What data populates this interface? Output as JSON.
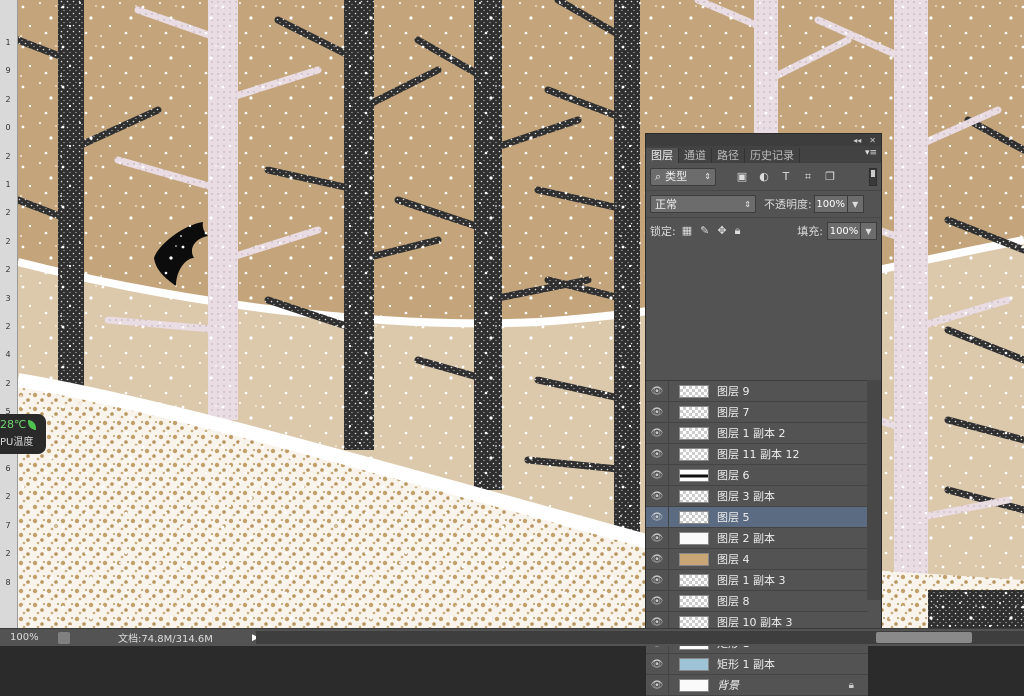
{
  "ruler": {
    "ticks": [
      "1",
      "9",
      "2",
      "0",
      "2",
      "1",
      "2",
      "2",
      "2",
      "3",
      "2",
      "4",
      "2",
      "5",
      "2",
      "6",
      "2",
      "7",
      "2",
      "8"
    ]
  },
  "widget": {
    "temperature": "28℃",
    "label": "PU温度"
  },
  "status": {
    "zoom": "100%",
    "doc": "文档:74.8M/314.6M",
    "arrow": "▶"
  },
  "panel": {
    "top_controls": {
      "collapse": "◂◂",
      "close": "✕"
    },
    "tabs": [
      "图层",
      "通道",
      "路径",
      "历史记录"
    ],
    "tab_menu": "▾≡",
    "filter": {
      "label": "类型",
      "icons": [
        "image-filter-icon",
        "adjustment-filter-icon",
        "type-filter-icon",
        "shape-filter-icon",
        "smart-object-filter-icon"
      ]
    },
    "blend_mode": "正常",
    "opacity_label": "不透明度:",
    "opacity_value": "100%",
    "lock_label": "锁定:",
    "fill_label": "填充:",
    "fill_value": "100%",
    "layers": [
      {
        "name": "图层 9",
        "thumb": "checker",
        "selected": false
      },
      {
        "name": "图层 7",
        "thumb": "checker",
        "selected": false
      },
      {
        "name": "图层 1 副本 2",
        "thumb": "checker",
        "selected": false
      },
      {
        "name": "图层 11 副本 12",
        "thumb": "checker",
        "selected": false
      },
      {
        "name": "图层 6",
        "thumb": "dark",
        "selected": false
      },
      {
        "name": "图层 3 副本",
        "thumb": "checker",
        "selected": false
      },
      {
        "name": "图层 5",
        "thumb": "checker",
        "selected": true
      },
      {
        "name": "图层 2 副本",
        "thumb": "white",
        "selected": false
      },
      {
        "name": "图层 4",
        "thumb": "tan",
        "selected": false
      },
      {
        "name": "图层 1 副本 3",
        "thumb": "checker",
        "selected": false
      },
      {
        "name": "图层 8",
        "thumb": "checker",
        "selected": false
      },
      {
        "name": "图层 10 副本 3",
        "thumb": "checker",
        "selected": false
      },
      {
        "name": "矩形 1",
        "thumb": "white",
        "selected": false
      },
      {
        "name": "矩形 1 副本",
        "thumb": "blue",
        "selected": false
      },
      {
        "name": "背景",
        "thumb": "white",
        "selected": false,
        "locked": true
      }
    ]
  },
  "colors": {
    "sky": "#c4a57b",
    "snow": "#ffffff",
    "trunk_dark": "#3a3a3a",
    "trunk_light": "#e6d6dc",
    "ground_tan": "#b8955f",
    "selected_layer": "#5a6b82"
  }
}
